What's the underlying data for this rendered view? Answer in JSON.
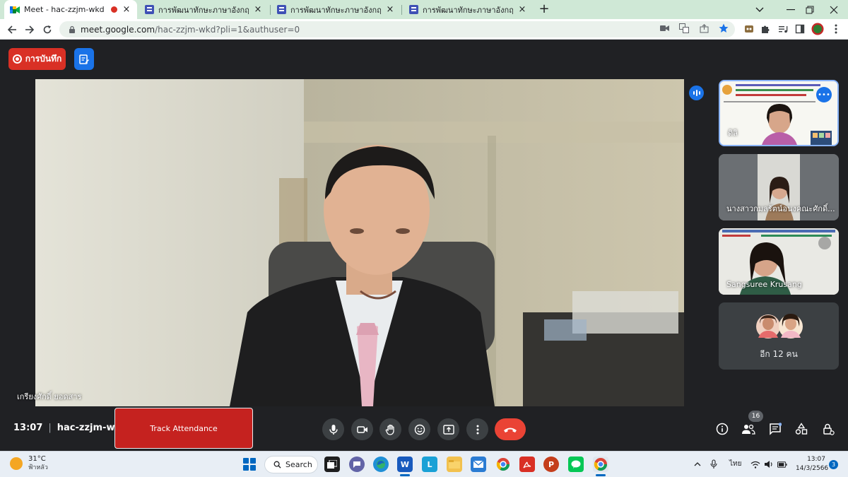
{
  "browser": {
    "tabs": [
      {
        "title": "Meet - hac-zzjm-wkd",
        "recording": true,
        "close": "×"
      },
      {
        "title": "การพัฒนาทักษะภาษาอังกฤษ English",
        "close": "×"
      },
      {
        "title": "การพัฒนาทักษะภาษาอังกฤษ English",
        "close": "×"
      },
      {
        "title": "การพัฒนาทักษะภาษาอังกฤษ English",
        "close": "×"
      }
    ],
    "new_tab": "+",
    "url_host": "meet.google.com",
    "url_path": "/hac-zzjm-wkd?pli=1&authuser=0"
  },
  "meet": {
    "record_label": "การบันทึก",
    "main_speaker": "เกรียงศักดิ์ ยอดสาร",
    "participants": [
      {
        "name": "ดิลิ"
      },
      {
        "name": "นางสาวกมลรัตน์อนงคณะศักดิ์..."
      },
      {
        "name": "Sangsuree Krusang"
      }
    ],
    "others_label": "อีก 12 คน",
    "time": "13:07",
    "meeting_code": "hac-zzjm-wkd",
    "track_attendance": "Track Attendance",
    "people_count": "16"
  },
  "taskbar": {
    "temperature": "31°C",
    "weather": "ฟ้าหลัว",
    "search_label": "Search",
    "language": "ไทย",
    "clock_time": "13:07",
    "clock_date": "14/3/2566",
    "notification_count": "3"
  },
  "colors": {
    "meet_bg": "#202124",
    "record_red": "#d93025",
    "end_call_red": "#ea4335",
    "accent_blue": "#1a73e8",
    "tab_strip": "#cfe8d6"
  }
}
